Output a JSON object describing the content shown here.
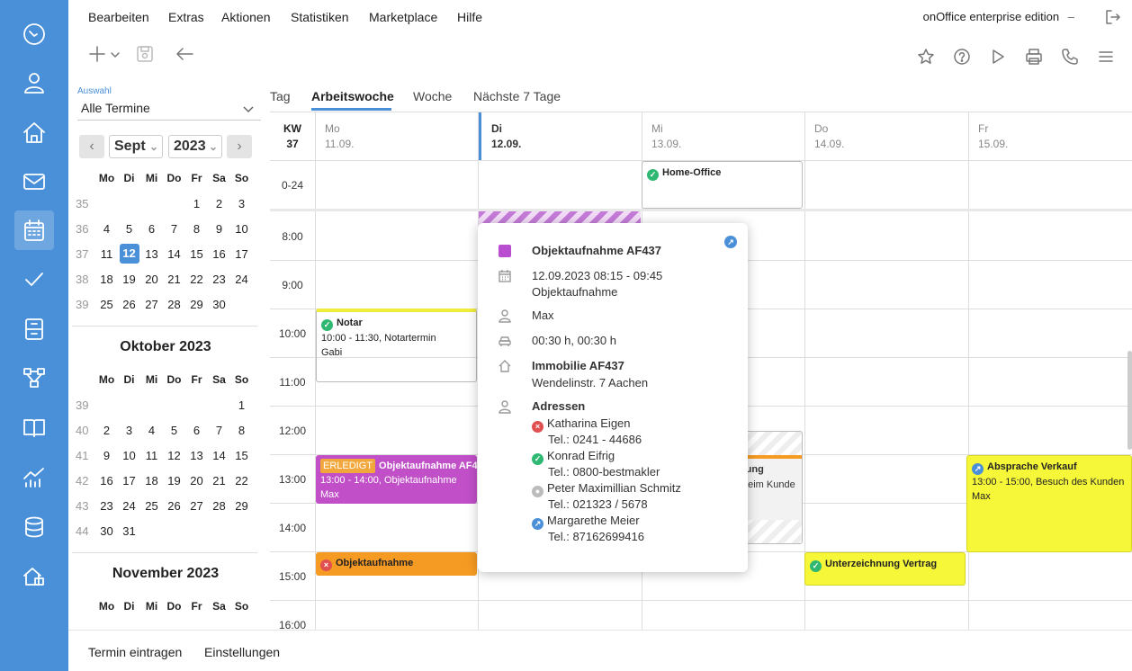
{
  "menu": {
    "items": [
      "Bearbeiten",
      "Extras",
      "Aktionen",
      "Statistiken",
      "Marketplace",
      "Hilfe"
    ],
    "edition": "onOffice enterprise edition",
    "edition_caret": "–"
  },
  "sidebar": {
    "items": [
      "dashboard-icon",
      "user-icon",
      "home-icon",
      "mail-icon",
      "calendar-icon",
      "tasks-check-icon",
      "filing-cabinet-icon",
      "workflow-icon",
      "book-icon",
      "statistics-icon",
      "database-icon",
      "property-icon"
    ],
    "active": "calendar-icon"
  },
  "selection": {
    "label": "Auswahl",
    "value": "Alle Termine"
  },
  "mini_calendar": {
    "month_select": "Sept",
    "year_select": "2023",
    "weekday_headers": [
      "Mo",
      "Di",
      "Mi",
      "Do",
      "Fr",
      "Sa",
      "So"
    ],
    "sept": {
      "rows": [
        {
          "wk": "35",
          "days": [
            "",
            "",
            "",
            "",
            "1",
            "2",
            "3"
          ]
        },
        {
          "wk": "36",
          "days": [
            "4",
            "5",
            "6",
            "7",
            "8",
            "9",
            "10"
          ]
        },
        {
          "wk": "37",
          "days": [
            "11",
            "12",
            "13",
            "14",
            "15",
            "16",
            "17"
          ]
        },
        {
          "wk": "38",
          "days": [
            "18",
            "19",
            "20",
            "21",
            "22",
            "23",
            "24"
          ]
        },
        {
          "wk": "39",
          "days": [
            "25",
            "26",
            "27",
            "28",
            "29",
            "30",
            ""
          ]
        }
      ]
    },
    "oct": {
      "title": "Oktober 2023",
      "rows": [
        {
          "wk": "39",
          "days": [
            "",
            "",
            "",
            "",
            "",
            "",
            "1"
          ]
        },
        {
          "wk": "40",
          "days": [
            "2",
            "3",
            "4",
            "5",
            "6",
            "7",
            "8"
          ]
        },
        {
          "wk": "41",
          "days": [
            "9",
            "10",
            "11",
            "12",
            "13",
            "14",
            "15"
          ]
        },
        {
          "wk": "42",
          "days": [
            "16",
            "17",
            "18",
            "19",
            "20",
            "21",
            "22"
          ]
        },
        {
          "wk": "43",
          "days": [
            "23",
            "24",
            "25",
            "26",
            "27",
            "28",
            "29"
          ]
        },
        {
          "wk": "44",
          "days": [
            "30",
            "31",
            "",
            "",
            "",
            "",
            ""
          ]
        }
      ]
    },
    "nov": {
      "title": "November 2023"
    },
    "today": "12"
  },
  "view_tabs": [
    "Tag",
    "Arbeitswoche",
    "Woche",
    "Nächste 7 Tage"
  ],
  "active_view": "Arbeitswoche",
  "grid": {
    "kw_label": "KW",
    "kw_number": "37",
    "days": [
      {
        "name": "Mo",
        "date": "11.09."
      },
      {
        "name": "Di",
        "date": "12.09."
      },
      {
        "name": "Mi",
        "date": "13.09."
      },
      {
        "name": "Do",
        "date": "14.09."
      },
      {
        "name": "Fr",
        "date": "15.09."
      }
    ],
    "allday_label": "0-24",
    "hours": [
      "8:00",
      "9:00",
      "10:00",
      "11:00",
      "12:00",
      "13:00",
      "14:00",
      "15:00",
      "16:00"
    ]
  },
  "events": {
    "home_office": {
      "title": "Home-Office"
    },
    "notar": {
      "title": "Notar",
      "line1": "10:00 - 11:30, Notartermin",
      "line2": "Gabi",
      "color": "#f0f0f0",
      "bar": "#f0ec3c"
    },
    "objektaufnahme_af4": {
      "badge": "ERLEDIGT",
      "title": "Objektaufnahme AF4",
      "line1": "13:00 - 14:00, Objektaufnahme",
      "line2": "Max",
      "color": "#c04fc8"
    },
    "objektaufnahme_orange": {
      "title": "Objektaufnahme",
      "color": "#f59a23"
    },
    "hidden_mi": {
      "line1": "tung",
      "line2": "beim Kunde"
    },
    "absprache": {
      "title": "Absprache Verkauf",
      "line1": "13:00 - 15:00, Besuch des Kunden",
      "line2": "Max",
      "color": "#f7f73a"
    },
    "unterzeichnung": {
      "title": "Unterzeichnung Vertrag",
      "color": "#f7f73a"
    }
  },
  "popup": {
    "title": "Objektaufnahme AF437",
    "color": "#b94fd0",
    "datetime": "12.09.2023 08:15 - 09:45",
    "type": "Objektaufnahme",
    "user": "Max",
    "duration": "00:30 h, 00:30 h",
    "property_title": "Immobilie AF437",
    "property_address": "Wendelinstr. 7 Aachen",
    "addresses_title": "Adressen",
    "addresses": [
      {
        "name": "Katharina Eigen",
        "tel": "Tel.: 0241 - 44686",
        "status": "no"
      },
      {
        "name": "Konrad Eifrig",
        "tel": "Tel.: 0800-bestmakler",
        "status": "ok"
      },
      {
        "name": "Peter Maximillian Schmitz",
        "tel": "Tel.: 021323 / 5678",
        "status": "neu"
      },
      {
        "name": "Margarethe Meier",
        "tel": "Tel.: 87162699416",
        "status": "arr"
      }
    ]
  },
  "bottom": {
    "new_appointment": "Termin eintragen",
    "settings": "Einstellungen"
  }
}
